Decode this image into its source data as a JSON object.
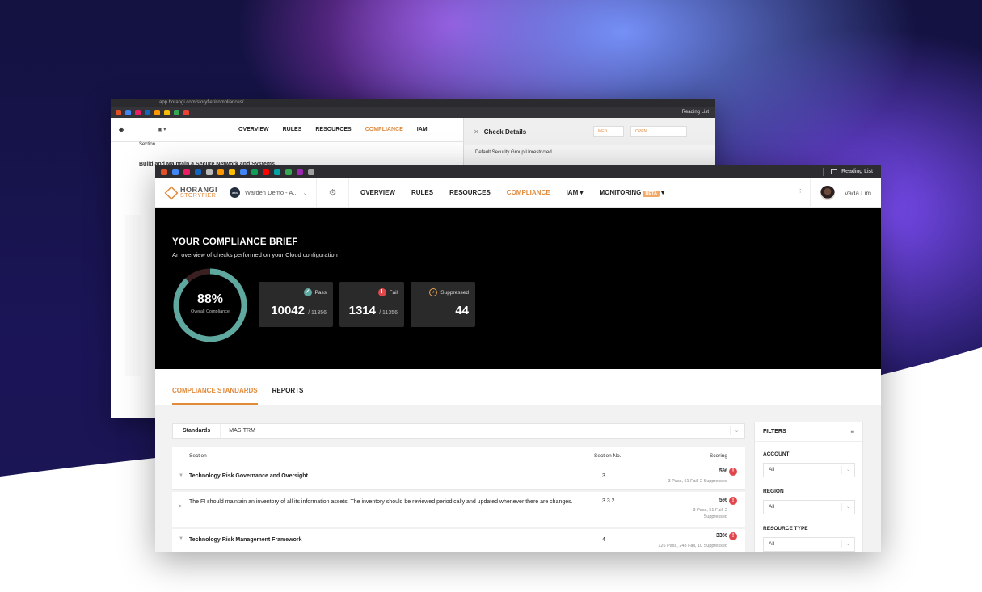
{
  "colors": {
    "accent": "#e08a3c",
    "pass": "#5fa8a0",
    "fail": "#e0474c",
    "hero_bg": "#000000"
  },
  "back_window": {
    "url": "app.horangi.com/storyfier/compliances/...",
    "nav": [
      "OVERVIEW",
      "RULES",
      "RESOURCES",
      "COMPLIANCE",
      "IAM"
    ],
    "active_nav": "COMPLIANCE",
    "reading_list": "Reading List",
    "section_header": "Section",
    "row1": "Build and Maintain a Secure Network and Systems",
    "panel_title": "Check Details",
    "panel_sev": "MED",
    "panel_status": "OPEN",
    "panel_check": "Default Security Group Unrestricted"
  },
  "browser": {
    "reading_list": "Reading List"
  },
  "topnav": {
    "logo_line1": "HORANGI",
    "logo_line2": "STORYFIER",
    "org_badge": "aws",
    "org_name": "Warden Demo - A...",
    "items": [
      {
        "label": "OVERVIEW"
      },
      {
        "label": "RULES"
      },
      {
        "label": "RESOURCES"
      },
      {
        "label": "COMPLIANCE"
      },
      {
        "label": "IAM"
      },
      {
        "label": "MONITORING"
      }
    ],
    "beta": "BETA",
    "user_name": "Vada Lim"
  },
  "hero": {
    "title": "YOUR COMPLIANCE BRIEF",
    "subtitle": "An overview of checks performed on your Cloud configuration",
    "overall_pct": "88%",
    "overall_fraction": 0.88,
    "overall_label": "Overall Compliance",
    "pass_label": "Pass",
    "pass_value": "10042",
    "pass_total": "/ 11356",
    "fail_label": "Fail",
    "fail_value": "1314",
    "fail_total": "/ 11356",
    "suppressed_label": "Suppressed",
    "suppressed_value": "44"
  },
  "tabs": [
    {
      "label": "COMPLIANCE STANDARDS"
    },
    {
      "label": "REPORTS"
    }
  ],
  "standards": {
    "label": "Standards",
    "value": "MAS-TRM"
  },
  "table": {
    "headers": {
      "section": "Section",
      "section_no": "Section No.",
      "scoring": "Scoring"
    },
    "rows": [
      {
        "section": "Technology Risk Governance and Oversight",
        "no": "3",
        "score": "5%",
        "detail": "3 Pass, 51 Fail, 2 Suppressed"
      },
      {
        "section": "The FI should maintain an inventory of all its information assets. The inventory should be reviewed periodically and updated whenever there are changes.",
        "no": "3.3.2",
        "score": "5%",
        "detail": "3 Pass, 51 Fail, 2 Suppressed"
      },
      {
        "section": "Technology Risk Management Framework",
        "no": "4",
        "score": "33%",
        "detail": "126 Pass, 248 Fail, 10 Suppressed"
      }
    ]
  },
  "filters": {
    "title": "FILTERS",
    "account_label": "ACCOUNT",
    "account_value": "All",
    "region_label": "REGION",
    "region_value": "All",
    "resource_label": "RESOURCE TYPE",
    "resource_value": "All"
  }
}
